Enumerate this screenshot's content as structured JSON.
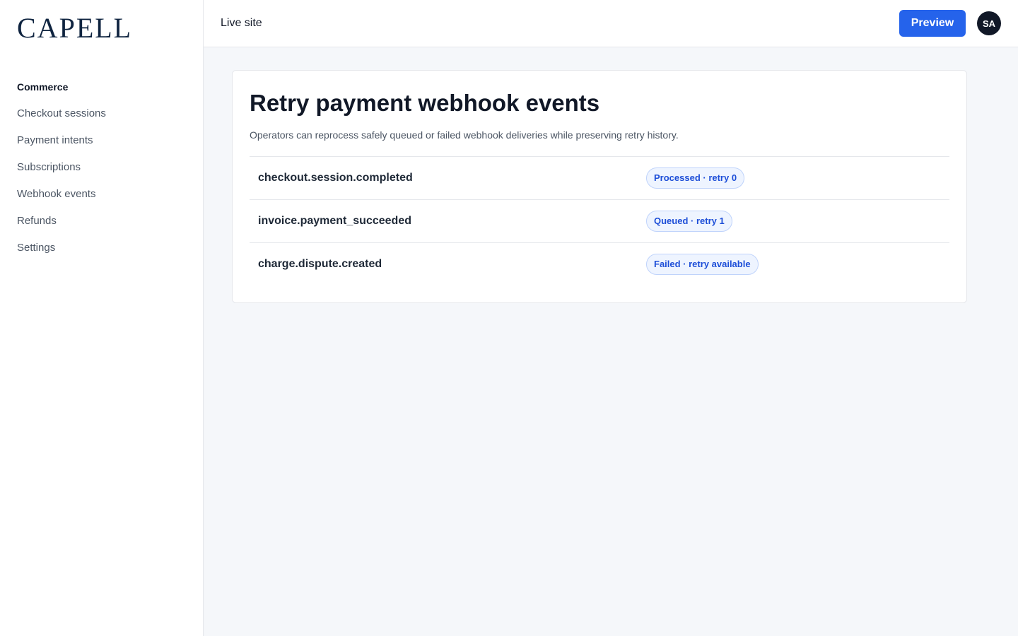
{
  "brand": {
    "logo_text": "CAPELL"
  },
  "sidebar": {
    "section_label": "Commerce",
    "items": [
      {
        "label": "Checkout sessions"
      },
      {
        "label": "Payment intents"
      },
      {
        "label": "Subscriptions"
      },
      {
        "label": "Webhook events"
      },
      {
        "label": "Refunds"
      },
      {
        "label": "Settings"
      }
    ]
  },
  "header": {
    "live_site_label": "Live site",
    "preview_label": "Preview",
    "avatar_initials": "SA"
  },
  "main": {
    "title": "Retry payment webhook events",
    "description": "Operators can reprocess safely queued or failed webhook deliveries while preserving retry history.",
    "events": [
      {
        "name": "checkout.session.completed",
        "status": "Processed · retry 0"
      },
      {
        "name": "invoice.payment_succeeded",
        "status": "Queued · retry 1"
      },
      {
        "name": "charge.dispute.created",
        "status": "Failed · retry available"
      }
    ]
  },
  "colors": {
    "accent": "#2563eb",
    "brand": "#0f2440",
    "badge_text": "#1d4ed8",
    "badge_bg": "#eef4ff"
  }
}
